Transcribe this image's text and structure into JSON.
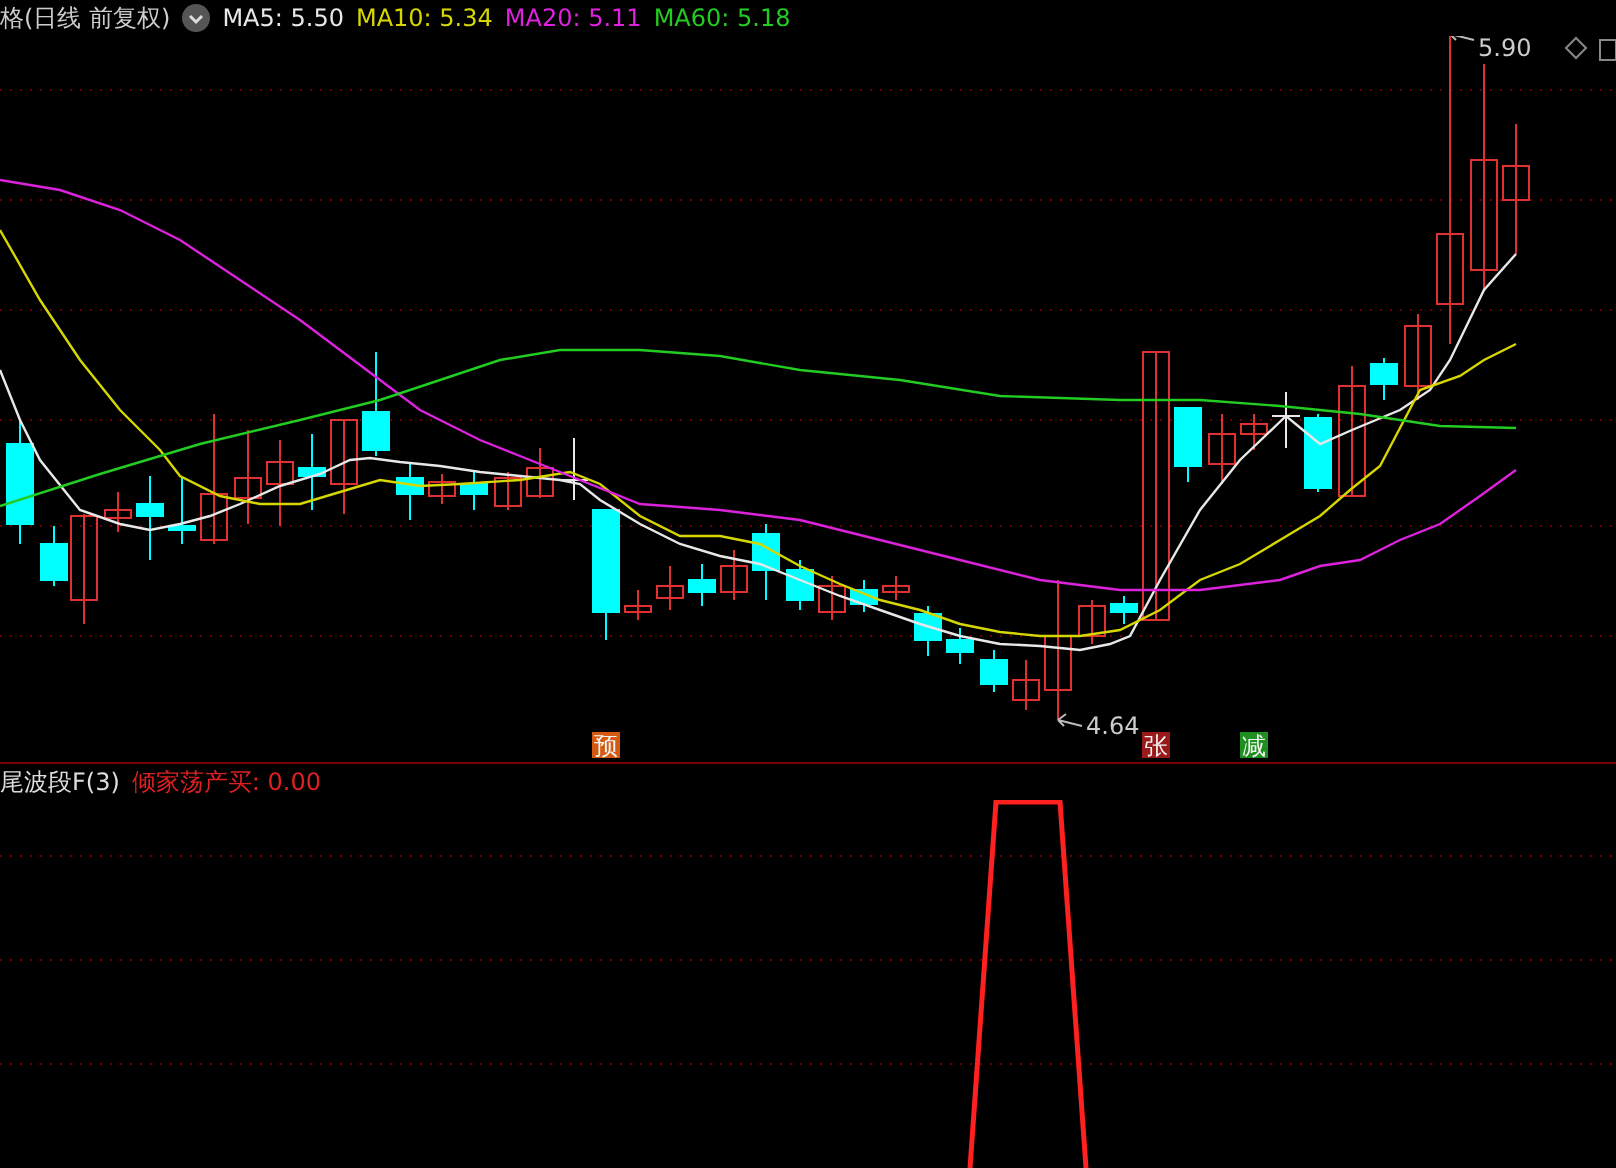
{
  "header": {
    "title": "格(日线 前复权)",
    "averages": [
      {
        "label": "MA5: 5.50",
        "color": "#e8e8e8"
      },
      {
        "label": "MA10: 5.34",
        "color": "#d6d600"
      },
      {
        "label": "MA20: 5.11",
        "color": "#dd22dd"
      },
      {
        "label": "MA60: 5.18",
        "color": "#22cc22"
      }
    ]
  },
  "price_labels": [
    {
      "kind": "high",
      "text": "5.90"
    },
    {
      "kind": "low",
      "text": "4.64"
    }
  ],
  "signals": [
    {
      "text": "预",
      "color": "#d35a10"
    },
    {
      "text": "张",
      "color": "#9a1a1a"
    },
    {
      "text": "减",
      "color": "#1f8f1f"
    }
  ],
  "indicator": {
    "name": "尾波段F(3)",
    "reading": "倾家荡产买: 0.00"
  }
}
